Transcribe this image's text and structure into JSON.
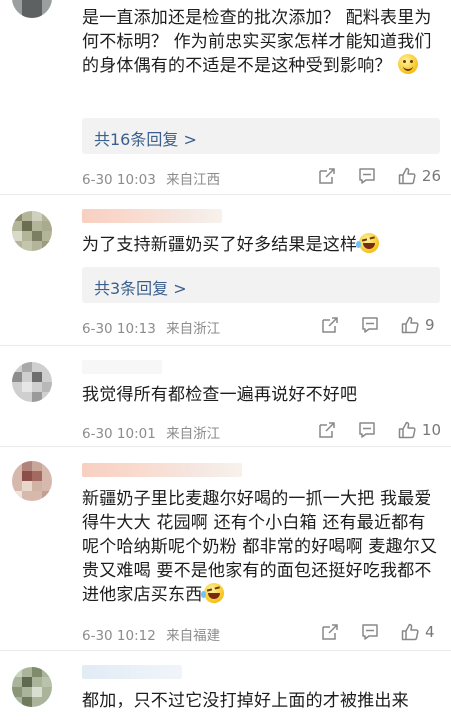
{
  "icons": {
    "share": "share-icon",
    "comment": "comment-icon",
    "like": "thumbs-up-icon"
  },
  "comments": [
    {
      "text": "是一直添加还是检查的批次添加？ 配料表里为何不标明？ 作为前忠实买家怎样才能知道我们的身体偶有的不适是不是这种受到影响？",
      "emoji": "smile-emoji",
      "replies_label": "共16条回复 >",
      "date": "6-30 10:03",
      "location": "来自江西",
      "likes": "26"
    },
    {
      "text": "为了支持新疆奶买了好多结果是这样",
      "emoji": "laugh-cry-emoji",
      "replies_label": "共3条回复 >",
      "date": "6-30 10:13",
      "location": "来自浙江",
      "likes": "9"
    },
    {
      "text": "我觉得所有都检查一遍再说好不好吧",
      "date": "6-30 10:01",
      "location": "来自浙江",
      "likes": "10"
    },
    {
      "text": "新疆奶子里比麦趣尔好喝的一抓一大把 我最爱得牛大大 花园啊 还有个小白箱 还有最近都有呢个哈纳斯呢个奶粉 都非常的好喝啊 麦趣尔又贵又难喝 要不是他家有的面包还挺好吃我都不进他家店买东西",
      "emoji": "laugh-cry-emoji",
      "date": "6-30 10:12",
      "location": "来自福建",
      "likes": "4"
    },
    {
      "text": "都加，只不过它没打掉好上面的才被推出来"
    }
  ]
}
